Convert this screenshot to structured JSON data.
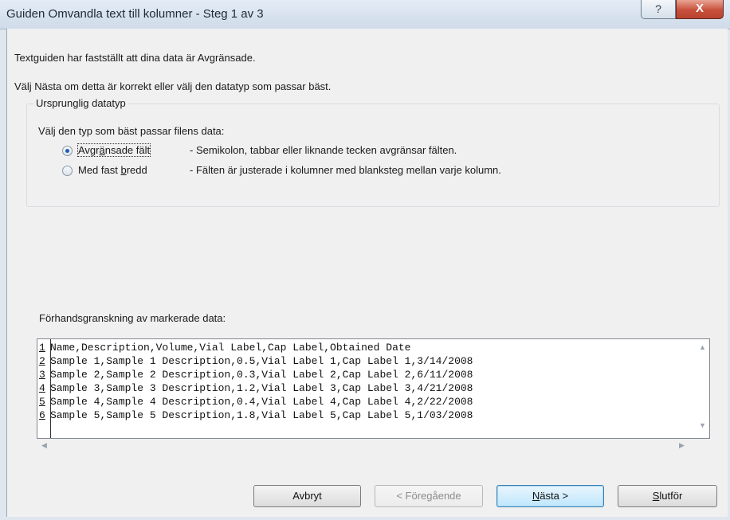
{
  "window": {
    "title": "Guiden Omvandla text till kolumner - Steg 1 av 3",
    "help_glyph": "?",
    "close_glyph": "X"
  },
  "intro": {
    "line1": "Textguiden har fastställt att dina data är Avgränsade.",
    "line2": "Välj Nästa om detta är korrekt eller välj den datatyp som passar bäst."
  },
  "datatype_group": {
    "legend": "Ursprunglig datatyp",
    "description": "Välj den typ som bäst passar filens data:",
    "options": [
      {
        "label_pre": "Avgr",
        "label_accel": "ä",
        "label_post": "nsade fält",
        "description": "- Semikolon, tabbar eller liknande tecken avgränsar fälten.",
        "checked": true
      },
      {
        "label_pre": "Med fast ",
        "label_accel": "b",
        "label_post": "redd",
        "description": "- Fälten är justerade i kolumner med blanksteg mellan varje kolumn.",
        "checked": false
      }
    ]
  },
  "preview": {
    "label": "Förhandsgranskning av markerade data:",
    "rows": [
      {
        "num": "1",
        "text": "Name,Description,Volume,Vial Label,Cap Label,Obtained Date"
      },
      {
        "num": "2",
        "text": "Sample 1,Sample 1 Description,0.5,Vial Label 1,Cap Label 1,3/14/2008"
      },
      {
        "num": "3",
        "text": "Sample 2,Sample 2 Description,0.3,Vial Label 2,Cap Label 2,6/11/2008"
      },
      {
        "num": "4",
        "text": "Sample 3,Sample 3 Description,1.2,Vial Label 3,Cap Label 3,4/21/2008"
      },
      {
        "num": "5",
        "text": "Sample 4,Sample 4 Description,0.4,Vial Label 4,Cap Label 4,2/22/2008"
      },
      {
        "num": "6",
        "text": "Sample 5,Sample 5 Description,1.8,Vial Label 5,Cap Label 5,1/03/2008"
      }
    ],
    "scroll_icons": {
      "up": "▲",
      "down": "▼",
      "left": "◀",
      "right": "▶"
    }
  },
  "buttons": {
    "cancel": "Avbryt",
    "back": "< Föregående",
    "next_accel": "N",
    "next_rest": "ästa >",
    "finish_accel": "S",
    "finish_rest": "lutför"
  },
  "colors": {
    "title_bar": "#cfdbe9",
    "close_button": "#c7503b",
    "dialog_background": "#f0f0f0"
  }
}
